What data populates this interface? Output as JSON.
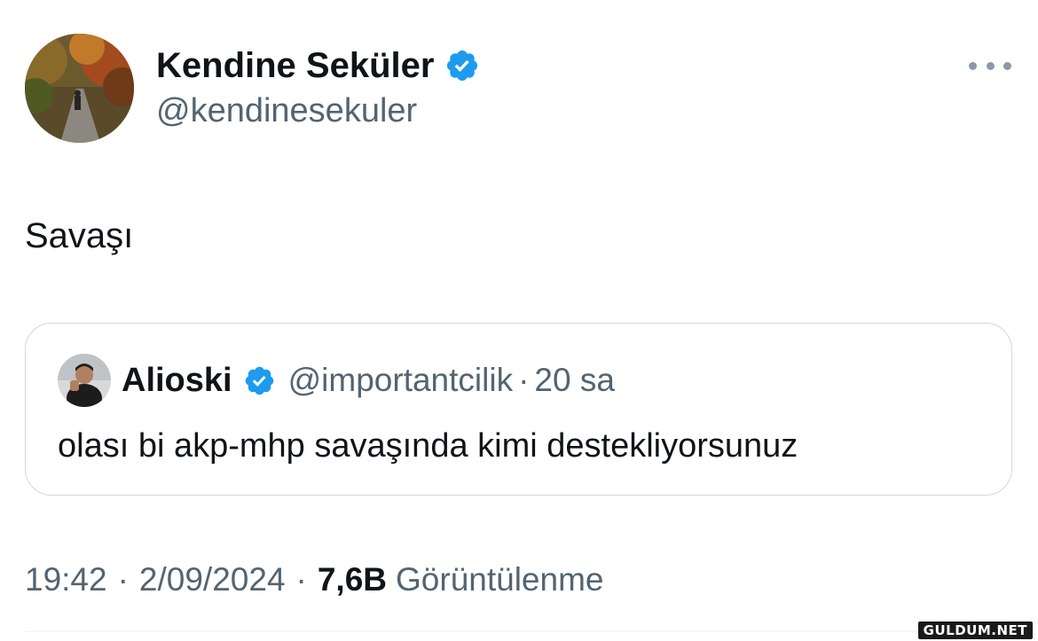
{
  "author": {
    "name": "Kendine Seküler",
    "handle": "@kendinesekuler",
    "verified": true
  },
  "tweet": {
    "text": "Savaşı"
  },
  "quoted_tweet": {
    "name": "Alioski",
    "handle": "@importantcilik",
    "separator": "·",
    "time": "20 sa",
    "text": "olası bi akp-mhp savaşında kimi destekliyorsunuz",
    "verified": true
  },
  "meta": {
    "time": "19:42",
    "date": "2/09/2024",
    "separator": "·",
    "views_count": "7,6B",
    "views_label": "Görüntülenme"
  },
  "icons": {
    "verified": "verified-badge-icon",
    "more": "more-horizontal-icon"
  },
  "colors": {
    "verified": "#1d9bf0",
    "secondary_text": "#536471",
    "primary_text": "#0f1419",
    "border": "#cfd9de"
  },
  "watermark": "GULDUM.NET"
}
